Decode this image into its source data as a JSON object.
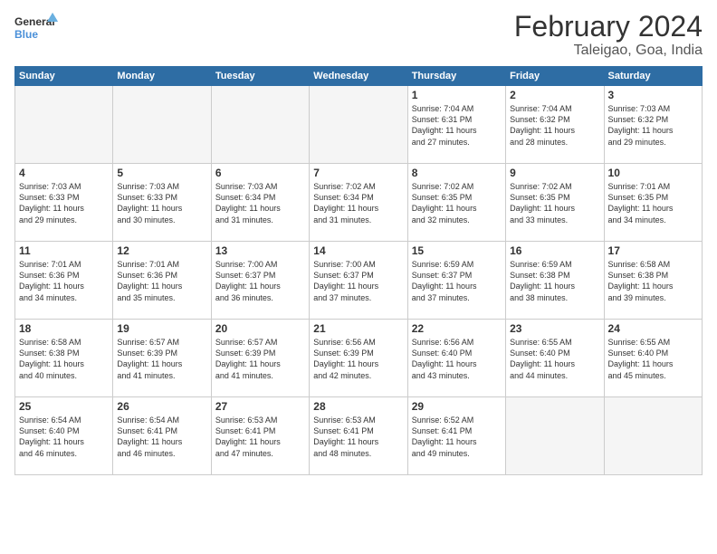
{
  "logo": {
    "line1": "General",
    "line2": "Blue"
  },
  "title": "February 2024",
  "subtitle": "Taleigao, Goa, India",
  "days_header": [
    "Sunday",
    "Monday",
    "Tuesday",
    "Wednesday",
    "Thursday",
    "Friday",
    "Saturday"
  ],
  "weeks": [
    [
      {
        "num": "",
        "content": "",
        "empty": true
      },
      {
        "num": "",
        "content": "",
        "empty": true
      },
      {
        "num": "",
        "content": "",
        "empty": true
      },
      {
        "num": "",
        "content": "",
        "empty": true
      },
      {
        "num": "1",
        "content": "Sunrise: 7:04 AM\nSunset: 6:31 PM\nDaylight: 11 hours\nand 27 minutes."
      },
      {
        "num": "2",
        "content": "Sunrise: 7:04 AM\nSunset: 6:32 PM\nDaylight: 11 hours\nand 28 minutes."
      },
      {
        "num": "3",
        "content": "Sunrise: 7:03 AM\nSunset: 6:32 PM\nDaylight: 11 hours\nand 29 minutes."
      }
    ],
    [
      {
        "num": "4",
        "content": "Sunrise: 7:03 AM\nSunset: 6:33 PM\nDaylight: 11 hours\nand 29 minutes."
      },
      {
        "num": "5",
        "content": "Sunrise: 7:03 AM\nSunset: 6:33 PM\nDaylight: 11 hours\nand 30 minutes."
      },
      {
        "num": "6",
        "content": "Sunrise: 7:03 AM\nSunset: 6:34 PM\nDaylight: 11 hours\nand 31 minutes."
      },
      {
        "num": "7",
        "content": "Sunrise: 7:02 AM\nSunset: 6:34 PM\nDaylight: 11 hours\nand 31 minutes."
      },
      {
        "num": "8",
        "content": "Sunrise: 7:02 AM\nSunset: 6:35 PM\nDaylight: 11 hours\nand 32 minutes."
      },
      {
        "num": "9",
        "content": "Sunrise: 7:02 AM\nSunset: 6:35 PM\nDaylight: 11 hours\nand 33 minutes."
      },
      {
        "num": "10",
        "content": "Sunrise: 7:01 AM\nSunset: 6:35 PM\nDaylight: 11 hours\nand 34 minutes."
      }
    ],
    [
      {
        "num": "11",
        "content": "Sunrise: 7:01 AM\nSunset: 6:36 PM\nDaylight: 11 hours\nand 34 minutes."
      },
      {
        "num": "12",
        "content": "Sunrise: 7:01 AM\nSunset: 6:36 PM\nDaylight: 11 hours\nand 35 minutes."
      },
      {
        "num": "13",
        "content": "Sunrise: 7:00 AM\nSunset: 6:37 PM\nDaylight: 11 hours\nand 36 minutes."
      },
      {
        "num": "14",
        "content": "Sunrise: 7:00 AM\nSunset: 6:37 PM\nDaylight: 11 hours\nand 37 minutes."
      },
      {
        "num": "15",
        "content": "Sunrise: 6:59 AM\nSunset: 6:37 PM\nDaylight: 11 hours\nand 37 minutes."
      },
      {
        "num": "16",
        "content": "Sunrise: 6:59 AM\nSunset: 6:38 PM\nDaylight: 11 hours\nand 38 minutes."
      },
      {
        "num": "17",
        "content": "Sunrise: 6:58 AM\nSunset: 6:38 PM\nDaylight: 11 hours\nand 39 minutes."
      }
    ],
    [
      {
        "num": "18",
        "content": "Sunrise: 6:58 AM\nSunset: 6:38 PM\nDaylight: 11 hours\nand 40 minutes."
      },
      {
        "num": "19",
        "content": "Sunrise: 6:57 AM\nSunset: 6:39 PM\nDaylight: 11 hours\nand 41 minutes."
      },
      {
        "num": "20",
        "content": "Sunrise: 6:57 AM\nSunset: 6:39 PM\nDaylight: 11 hours\nand 41 minutes."
      },
      {
        "num": "21",
        "content": "Sunrise: 6:56 AM\nSunset: 6:39 PM\nDaylight: 11 hours\nand 42 minutes."
      },
      {
        "num": "22",
        "content": "Sunrise: 6:56 AM\nSunset: 6:40 PM\nDaylight: 11 hours\nand 43 minutes."
      },
      {
        "num": "23",
        "content": "Sunrise: 6:55 AM\nSunset: 6:40 PM\nDaylight: 11 hours\nand 44 minutes."
      },
      {
        "num": "24",
        "content": "Sunrise: 6:55 AM\nSunset: 6:40 PM\nDaylight: 11 hours\nand 45 minutes."
      }
    ],
    [
      {
        "num": "25",
        "content": "Sunrise: 6:54 AM\nSunset: 6:40 PM\nDaylight: 11 hours\nand 46 minutes."
      },
      {
        "num": "26",
        "content": "Sunrise: 6:54 AM\nSunset: 6:41 PM\nDaylight: 11 hours\nand 46 minutes."
      },
      {
        "num": "27",
        "content": "Sunrise: 6:53 AM\nSunset: 6:41 PM\nDaylight: 11 hours\nand 47 minutes."
      },
      {
        "num": "28",
        "content": "Sunrise: 6:53 AM\nSunset: 6:41 PM\nDaylight: 11 hours\nand 48 minutes."
      },
      {
        "num": "29",
        "content": "Sunrise: 6:52 AM\nSunset: 6:41 PM\nDaylight: 11 hours\nand 49 minutes."
      },
      {
        "num": "",
        "content": "",
        "empty": true
      },
      {
        "num": "",
        "content": "",
        "empty": true
      }
    ]
  ]
}
